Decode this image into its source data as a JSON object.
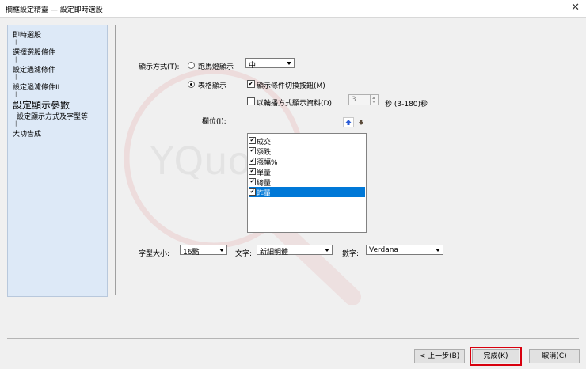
{
  "window": {
    "title": "欄框設定精靈 — 設定即時選股"
  },
  "steps": [
    {
      "label": "即時選股"
    },
    {
      "label": "選擇選股條件"
    },
    {
      "label": "設定過濾條件"
    },
    {
      "label": "設定過濾條件II"
    },
    {
      "label": "設定顯示參數"
    },
    {
      "label": "設定顯示方式及字型等"
    },
    {
      "label": "大功告成"
    }
  ],
  "step_separator": "|",
  "display_mode": {
    "label": "顯示方式(T):",
    "marquee_label": "跑馬燈顯示",
    "marquee_speed": "中",
    "table_label": "表格顯示",
    "selected": "table"
  },
  "toggle_button": {
    "label": "顯示條件切換按鈕(M)",
    "checked": true
  },
  "rotate": {
    "label": "以輪播方式顯示資料(D)",
    "checked": false,
    "value": "3",
    "unit_label": "秒 (3-180)秒"
  },
  "columns": {
    "label": "欄位(I):",
    "items": [
      {
        "label": "成交",
        "checked": true,
        "selected": false
      },
      {
        "label": "漲跌",
        "checked": true,
        "selected": false
      },
      {
        "label": "漲幅%",
        "checked": true,
        "selected": false
      },
      {
        "label": "單量",
        "checked": true,
        "selected": false
      },
      {
        "label": "總量",
        "checked": true,
        "selected": false
      },
      {
        "label": "昨量",
        "checked": true,
        "selected": true
      }
    ]
  },
  "font": {
    "size_label": "字型大小:",
    "size_value": "16點",
    "text_label": "文字:",
    "text_value": "新細明體",
    "number_label": "數字:",
    "number_value": "Verdana"
  },
  "buttons": {
    "back": "< 上一步(B)",
    "finish": "完成(K)",
    "cancel": "取消(C)"
  },
  "watermark": {
    "text": "YQuote"
  },
  "colors": {
    "selection": "#0078d7",
    "highlight_box": "#d8000e",
    "sidebar": "#dde9f7"
  }
}
